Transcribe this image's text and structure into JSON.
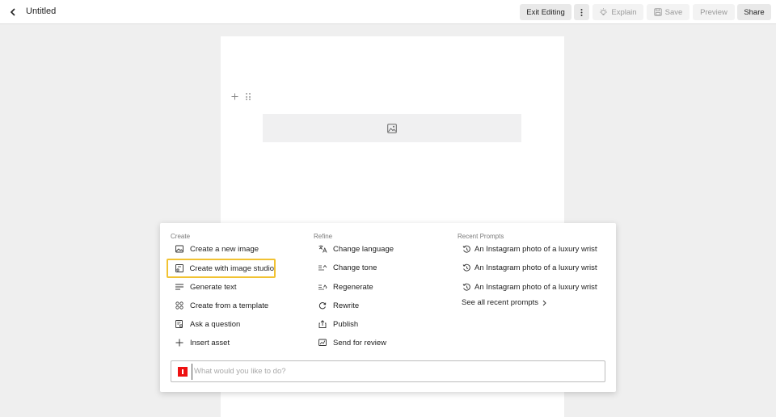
{
  "header": {
    "title": "Untitled",
    "exit_editing": "Exit Editing",
    "more_icon": "vertical-ellipsis-icon",
    "explain": "Explain",
    "save": "Save",
    "preview": "Preview",
    "share": "Share"
  },
  "canvas": {
    "add_icon": "plus-icon",
    "drag_icon": "drag-handle-icon",
    "placeholder_icon": "image-icon"
  },
  "ai_panel": {
    "create": {
      "heading": "Create",
      "items": [
        {
          "label": "Create a new image",
          "icon": "image-icon"
        },
        {
          "label": "Create with image studio",
          "icon": "image-studio-icon"
        },
        {
          "label": "Generate text",
          "icon": "text-lines-icon"
        },
        {
          "label": "Create from a template",
          "icon": "template-grid-icon"
        },
        {
          "label": "Ask a question",
          "icon": "question-doc-icon"
        },
        {
          "label": "Insert asset",
          "icon": "plus-icon"
        }
      ]
    },
    "refine": {
      "heading": "Refine",
      "items": [
        {
          "label": "Change language",
          "icon": "translate-icon"
        },
        {
          "label": "Change tone",
          "icon": "tone-icon"
        },
        {
          "label": "Regenerate",
          "icon": "regenerate-icon"
        },
        {
          "label": "Rewrite",
          "icon": "rewrite-icon"
        },
        {
          "label": "Publish",
          "icon": "publish-icon"
        },
        {
          "label": "Send for review",
          "icon": "review-icon"
        }
      ]
    },
    "recent": {
      "heading": "Recent Prompts",
      "items": [
        {
          "label": "An Instagram photo of a luxury wristwa",
          "icon": "history-icon"
        },
        {
          "label": "An Instagram photo of a luxury wristwa",
          "icon": "history-icon"
        },
        {
          "label": "An Instagram photo of a luxury wristwa",
          "icon": "history-icon"
        }
      ],
      "see_all": "See all recent prompts",
      "see_all_icon": "chevron-right-icon"
    },
    "prompt": {
      "placeholder": "What would you like to do?",
      "value": ""
    }
  },
  "colors": {
    "highlight": "#f1c232",
    "brand": "#ee1111"
  }
}
